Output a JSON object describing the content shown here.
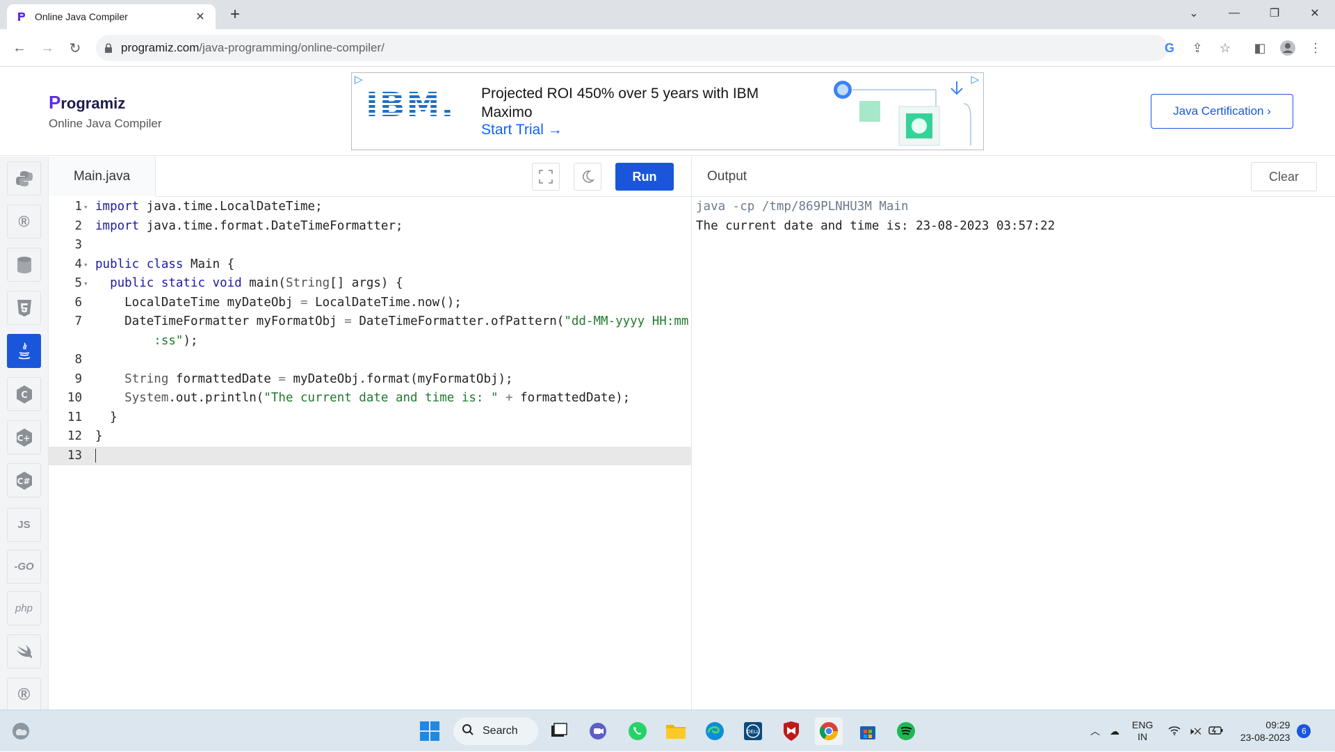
{
  "browser": {
    "tab_title": "Online Java Compiler",
    "url_host": "programiz.com",
    "url_path": "/java-programming/online-compiler/"
  },
  "header": {
    "logo_initial": "P",
    "logo_rest": "rogramiz",
    "subtitle": "Online Java Compiler",
    "cert_button": "Java Certification ›"
  },
  "ad": {
    "brand": "IBM.",
    "headline": "Projected ROI 450% over 5 years with IBM Maximo",
    "cta": "Start Trial"
  },
  "sidebar": {
    "items": [
      "python-icon",
      "r-icon",
      "sql-icon",
      "html-icon",
      "java-icon",
      "c-icon",
      "cpp-icon",
      "csharp-icon",
      "JS",
      "GO",
      "php",
      "swift-icon",
      "rust-icon"
    ],
    "active": "java-icon",
    "js_label": "JS",
    "go_label": "-GO",
    "php_label": "php"
  },
  "editor": {
    "file_tab": "Main.java",
    "run_label": "Run",
    "lines": [
      {
        "n": "1",
        "text": "import java.time.LocalDateTime;"
      },
      {
        "n": "2",
        "text": "import java.time.format.DateTimeFormatter;"
      },
      {
        "n": "3",
        "text": ""
      },
      {
        "n": "4",
        "text": "public class Main {"
      },
      {
        "n": "5",
        "text": "  public static void main(String[] args) {"
      },
      {
        "n": "6",
        "text": "    LocalDateTime myDateObj = LocalDateTime.now();"
      },
      {
        "n": "7",
        "text": "    DateTimeFormatter myFormatObj = DateTimeFormatter.ofPattern(\"dd-MM-yyyy HH:mm:ss\");"
      },
      {
        "n": "8",
        "text": ""
      },
      {
        "n": "9",
        "text": "    String formattedDate = myDateObj.format(myFormatObj);"
      },
      {
        "n": "10",
        "text": "    System.out.println(\"The current date and time is: \" + formattedDate);"
      },
      {
        "n": "11",
        "text": "  }"
      },
      {
        "n": "12",
        "text": "}"
      },
      {
        "n": "13",
        "text": ""
      }
    ]
  },
  "output": {
    "label": "Output",
    "clear_label": "Clear",
    "command": "java -cp /tmp/869PLNHU3M Main",
    "result": "The current date and time is: 23-08-2023 03:57:22"
  },
  "taskbar": {
    "search_label": "Search",
    "lang_top": "ENG",
    "lang_bottom": "IN",
    "time": "09:29",
    "date": "23-08-2023",
    "notifications": "6"
  }
}
